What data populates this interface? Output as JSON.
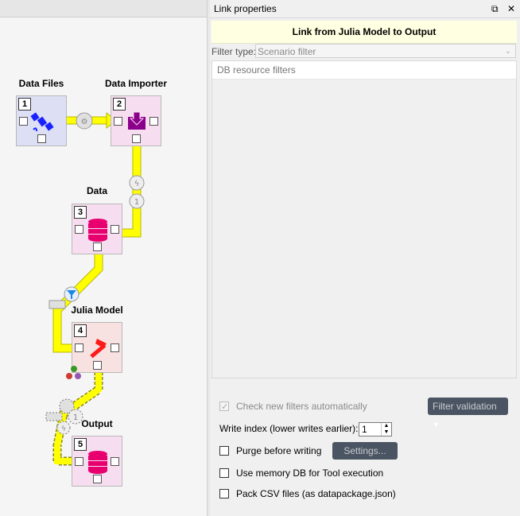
{
  "canvas": {
    "nodes": [
      {
        "label": "Data Files",
        "number": "1",
        "kind": "data-connection",
        "color": "#dde0f5"
      },
      {
        "label": "Data Importer",
        "number": "2",
        "kind": "importer",
        "color": "#f6ddef"
      },
      {
        "label": "Data",
        "number": "3",
        "kind": "data-store",
        "color": "#f6ddef"
      },
      {
        "label": "Julia Model",
        "number": "4",
        "kind": "tool",
        "color": "#f8e1e1"
      },
      {
        "label": "Output",
        "number": "5",
        "kind": "data-store",
        "color": "#f6ddef"
      }
    ],
    "link_badge_text": "1",
    "link_color": "#ffff00"
  },
  "dock": {
    "title": "Link properties",
    "float_icon": "float-icon",
    "close_icon": "close-icon"
  },
  "link": {
    "banner": "Link from Julia Model to Output",
    "filter_type_label": "Filter type:",
    "filter_type_value": "Scenario filter",
    "filters_header": "DB resource filters",
    "check_new_filters_label": "Check new filters automatically",
    "filter_validation_label": "Filter validation",
    "write_index_label": "Write index (lower writes earlier):",
    "write_index_value": "1",
    "purge_label": "Purge before writing",
    "settings_label": "Settings...",
    "memory_db_label": "Use memory DB for Tool execution",
    "pack_csv_label": "Pack CSV files (as datapackage.json)"
  }
}
